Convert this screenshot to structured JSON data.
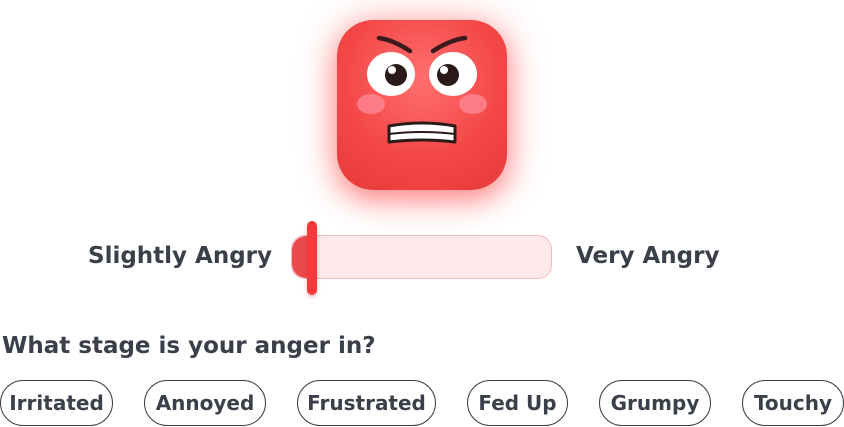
{
  "face": {
    "icon": "angry-face-icon",
    "color": "#f44848"
  },
  "slider": {
    "min_label": "Slightly Angry",
    "max_label": "Very Angry",
    "value": 0.08,
    "fill_color": "#ea4a4a",
    "track_color": "#fde8ea",
    "thumb_color": "#f43a3a"
  },
  "question": "What stage is your anger in?",
  "options": [
    "Irritated",
    "Annoyed",
    "Frustrated",
    "Fed Up",
    "Grumpy",
    "Touchy"
  ]
}
